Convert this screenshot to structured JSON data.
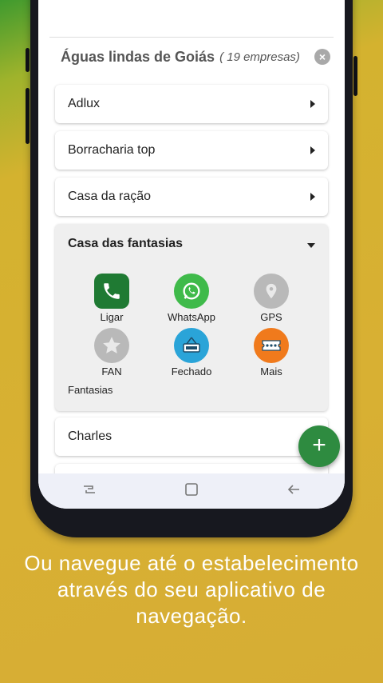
{
  "group": {
    "title": "Águas lindas de Goiás",
    "count": "( 19 empresas)"
  },
  "items": [
    {
      "label": "Adlux"
    },
    {
      "label": "Borracharia top"
    },
    {
      "label": "Casa da ração"
    }
  ],
  "expanded": {
    "title": "Casa das fantasias",
    "actions": [
      {
        "label": "Ligar",
        "icon": "phone-icon",
        "color": "#1f7a33"
      },
      {
        "label": "WhatsApp",
        "icon": "whatsapp-icon",
        "color": "#3fba4a"
      },
      {
        "label": "GPS",
        "icon": "gps-icon",
        "color": "#b9b9b9"
      },
      {
        "label": "FAN",
        "icon": "star-icon",
        "color": "#b9b9b9"
      },
      {
        "label": "Fechado",
        "icon": "closed-sign-icon",
        "color": "#2aa4d8"
      },
      {
        "label": "Mais",
        "icon": "more-icon",
        "color": "#f07a1c"
      }
    ],
    "description": "Fantasias"
  },
  "after_items": [
    {
      "label": "Charles"
    }
  ],
  "fab": {
    "icon": "plus-icon",
    "label": "+"
  },
  "caption": "Ou navegue até o estabelecimento através do seu aplicativo de navegação."
}
